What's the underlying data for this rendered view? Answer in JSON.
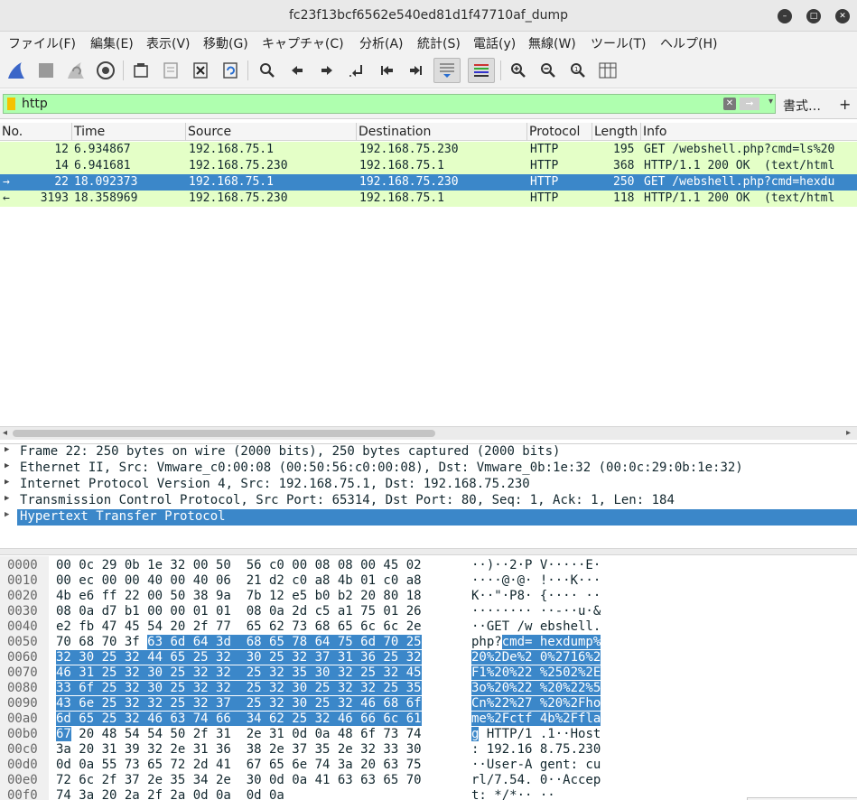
{
  "window": {
    "title": "fc23f13bcf6562e540ed81d1f47710af_dump",
    "buttons": [
      "minimize",
      "maximize",
      "close"
    ]
  },
  "menu": {
    "items": [
      "ファイル(F)",
      "編集(E)",
      "表示(V)",
      "移動(G)",
      "キャプチャ(C)",
      "分析(A)",
      "統計(S)",
      "電話(y)",
      "無線(W)",
      "ツール(T)",
      "ヘルプ(H)"
    ]
  },
  "filter": {
    "value": "http",
    "expression_label": "書式…",
    "add_label": "+"
  },
  "packet_list": {
    "columns": [
      "No.",
      "Time",
      "Source",
      "Destination",
      "Protocol",
      "Length",
      "Info"
    ],
    "rows": [
      {
        "no": "12",
        "time": "6.934867",
        "src": "192.168.75.1",
        "dst": "192.168.75.230",
        "proto": "HTTP",
        "len": "195",
        "info": "GET /webshell.php?cmd=ls%20",
        "marker": ""
      },
      {
        "no": "14",
        "time": "6.941681",
        "src": "192.168.75.230",
        "dst": "192.168.75.1",
        "proto": "HTTP",
        "len": "368",
        "info": "HTTP/1.1 200 OK  (text/html",
        "marker": ""
      },
      {
        "no": "22",
        "time": "18.092373",
        "src": "192.168.75.1",
        "dst": "192.168.75.230",
        "proto": "HTTP",
        "len": "250",
        "info": "GET /webshell.php?cmd=hexdu",
        "marker": "→"
      },
      {
        "no": "3193",
        "time": "18.358969",
        "src": "192.168.75.230",
        "dst": "192.168.75.1",
        "proto": "HTTP",
        "len": "118",
        "info": "HTTP/1.1 200 OK  (text/html",
        "marker": "←"
      }
    ],
    "selected_index": 2
  },
  "details": {
    "rows": [
      "Frame 22: 250 bytes on wire (2000 bits), 250 bytes captured (2000 bits)",
      "Ethernet II, Src: Vmware_c0:00:08 (00:50:56:c0:00:08), Dst: Vmware_0b:1e:32 (00:0c:29:0b:1e:32)",
      "Internet Protocol Version 4, Src: 192.168.75.1, Dst: 192.168.75.230",
      "Transmission Control Protocol, Src Port: 65314, Dst Port: 80, Seq: 1, Ack: 1, Len: 184",
      "Hypertext Transfer Protocol"
    ],
    "selected_index": 4
  },
  "hex": {
    "rows": [
      {
        "off": "0000",
        "pre": "00 0c 29 0b 1e 32 00 50  56 c0 00 08 08 00 45 02",
        "hl": "",
        "post": "",
        "apre": "··)··2·P V·····E·",
        "ahl": "",
        "apost": ""
      },
      {
        "off": "0010",
        "pre": "00 ec 00 00 40 00 40 06  21 d2 c0 a8 4b 01 c0 a8",
        "hl": "",
        "post": "",
        "apre": "····@·@· !···K···",
        "ahl": "",
        "apost": ""
      },
      {
        "off": "0020",
        "pre": "4b e6 ff 22 00 50 38 9a  7b 12 e5 b0 b2 20 80 18",
        "hl": "",
        "post": "",
        "apre": "K··\"·P8· {···· ··",
        "ahl": "",
        "apost": ""
      },
      {
        "off": "0030",
        "pre": "08 0a d7 b1 00 00 01 01  08 0a 2d c5 a1 75 01 26",
        "hl": "",
        "post": "",
        "apre": "········ ··-··u·&",
        "ahl": "",
        "apost": ""
      },
      {
        "off": "0040",
        "pre": "e2 fb 47 45 54 20 2f 77  65 62 73 68 65 6c 6c 2e",
        "hl": "",
        "post": "",
        "apre": "··GET /w ebshell.",
        "ahl": "",
        "apost": ""
      },
      {
        "off": "0050",
        "pre": "70 68 70 3f ",
        "hl": "63 6d 64 3d  68 65 78 64 75 6d 70 25",
        "post": "",
        "apre": "php?",
        "ahl": "cmd= hexdump%",
        "apost": ""
      },
      {
        "off": "0060",
        "pre": "",
        "hl": "32 30 25 32 44 65 25 32  30 25 32 37 31 36 25 32",
        "post": "",
        "apre": "",
        "ahl": "20%2De%2 0%2716%2",
        "apost": ""
      },
      {
        "off": "0070",
        "pre": "",
        "hl": "46 31 25 32 30 25 32 32  25 32 35 30 32 25 32 45",
        "post": "",
        "apre": "",
        "ahl": "F1%20%22 %2502%2E",
        "apost": ""
      },
      {
        "off": "0080",
        "pre": "",
        "hl": "33 6f 25 32 30 25 32 32  25 32 30 25 32 32 25 35",
        "post": "",
        "apre": "",
        "ahl": "3o%20%22 %20%22%5",
        "apost": ""
      },
      {
        "off": "0090",
        "pre": "",
        "hl": "43 6e 25 32 32 25 32 37  25 32 30 25 32 46 68 6f",
        "post": "",
        "apre": "",
        "ahl": "Cn%22%27 %20%2Fho",
        "apost": ""
      },
      {
        "off": "00a0",
        "pre": "",
        "hl": "6d 65 25 32 46 63 74 66  34 62 25 32 46 66 6c 61",
        "post": "",
        "apre": "",
        "ahl": "me%2Fctf 4b%2Ffla",
        "apost": ""
      },
      {
        "off": "00b0",
        "pre": "",
        "hl": "67",
        "post": " 20 48 54 54 50 2f 31  2e 31 0d 0a 48 6f 73 74",
        "apre": "",
        "ahl": "g",
        "apost": " HTTP/1 .1··Host"
      },
      {
        "off": "00c0",
        "pre": "3a 20 31 39 32 2e 31 36  38 2e 37 35 2e 32 33 30",
        "hl": "",
        "post": "",
        "apre": ": 192.16 8.75.230",
        "ahl": "",
        "apost": ""
      },
      {
        "off": "00d0",
        "pre": "0d 0a 55 73 65 72 2d 41  67 65 6e 74 3a 20 63 75",
        "hl": "",
        "post": "",
        "apre": "··User-A gent: cu",
        "ahl": "",
        "apost": ""
      },
      {
        "off": "00e0",
        "pre": "72 6c 2f 37 2e 35 34 2e  30 0d 0a 41 63 63 65 70",
        "hl": "",
        "post": "",
        "apre": "rl/7.54. 0··Accep",
        "ahl": "",
        "apost": ""
      },
      {
        "off": "00f0",
        "pre": "74 3a 20 2a 2f 2a 0d 0a  0d 0a",
        "hl": "",
        "post": "",
        "apre": "t: */*·· ··",
        "ahl": "",
        "apost": ""
      }
    ]
  },
  "colors": {
    "http_row": "#e4ffc7",
    "selection": "#3b87c9",
    "filter_valid": "#afffaf"
  }
}
